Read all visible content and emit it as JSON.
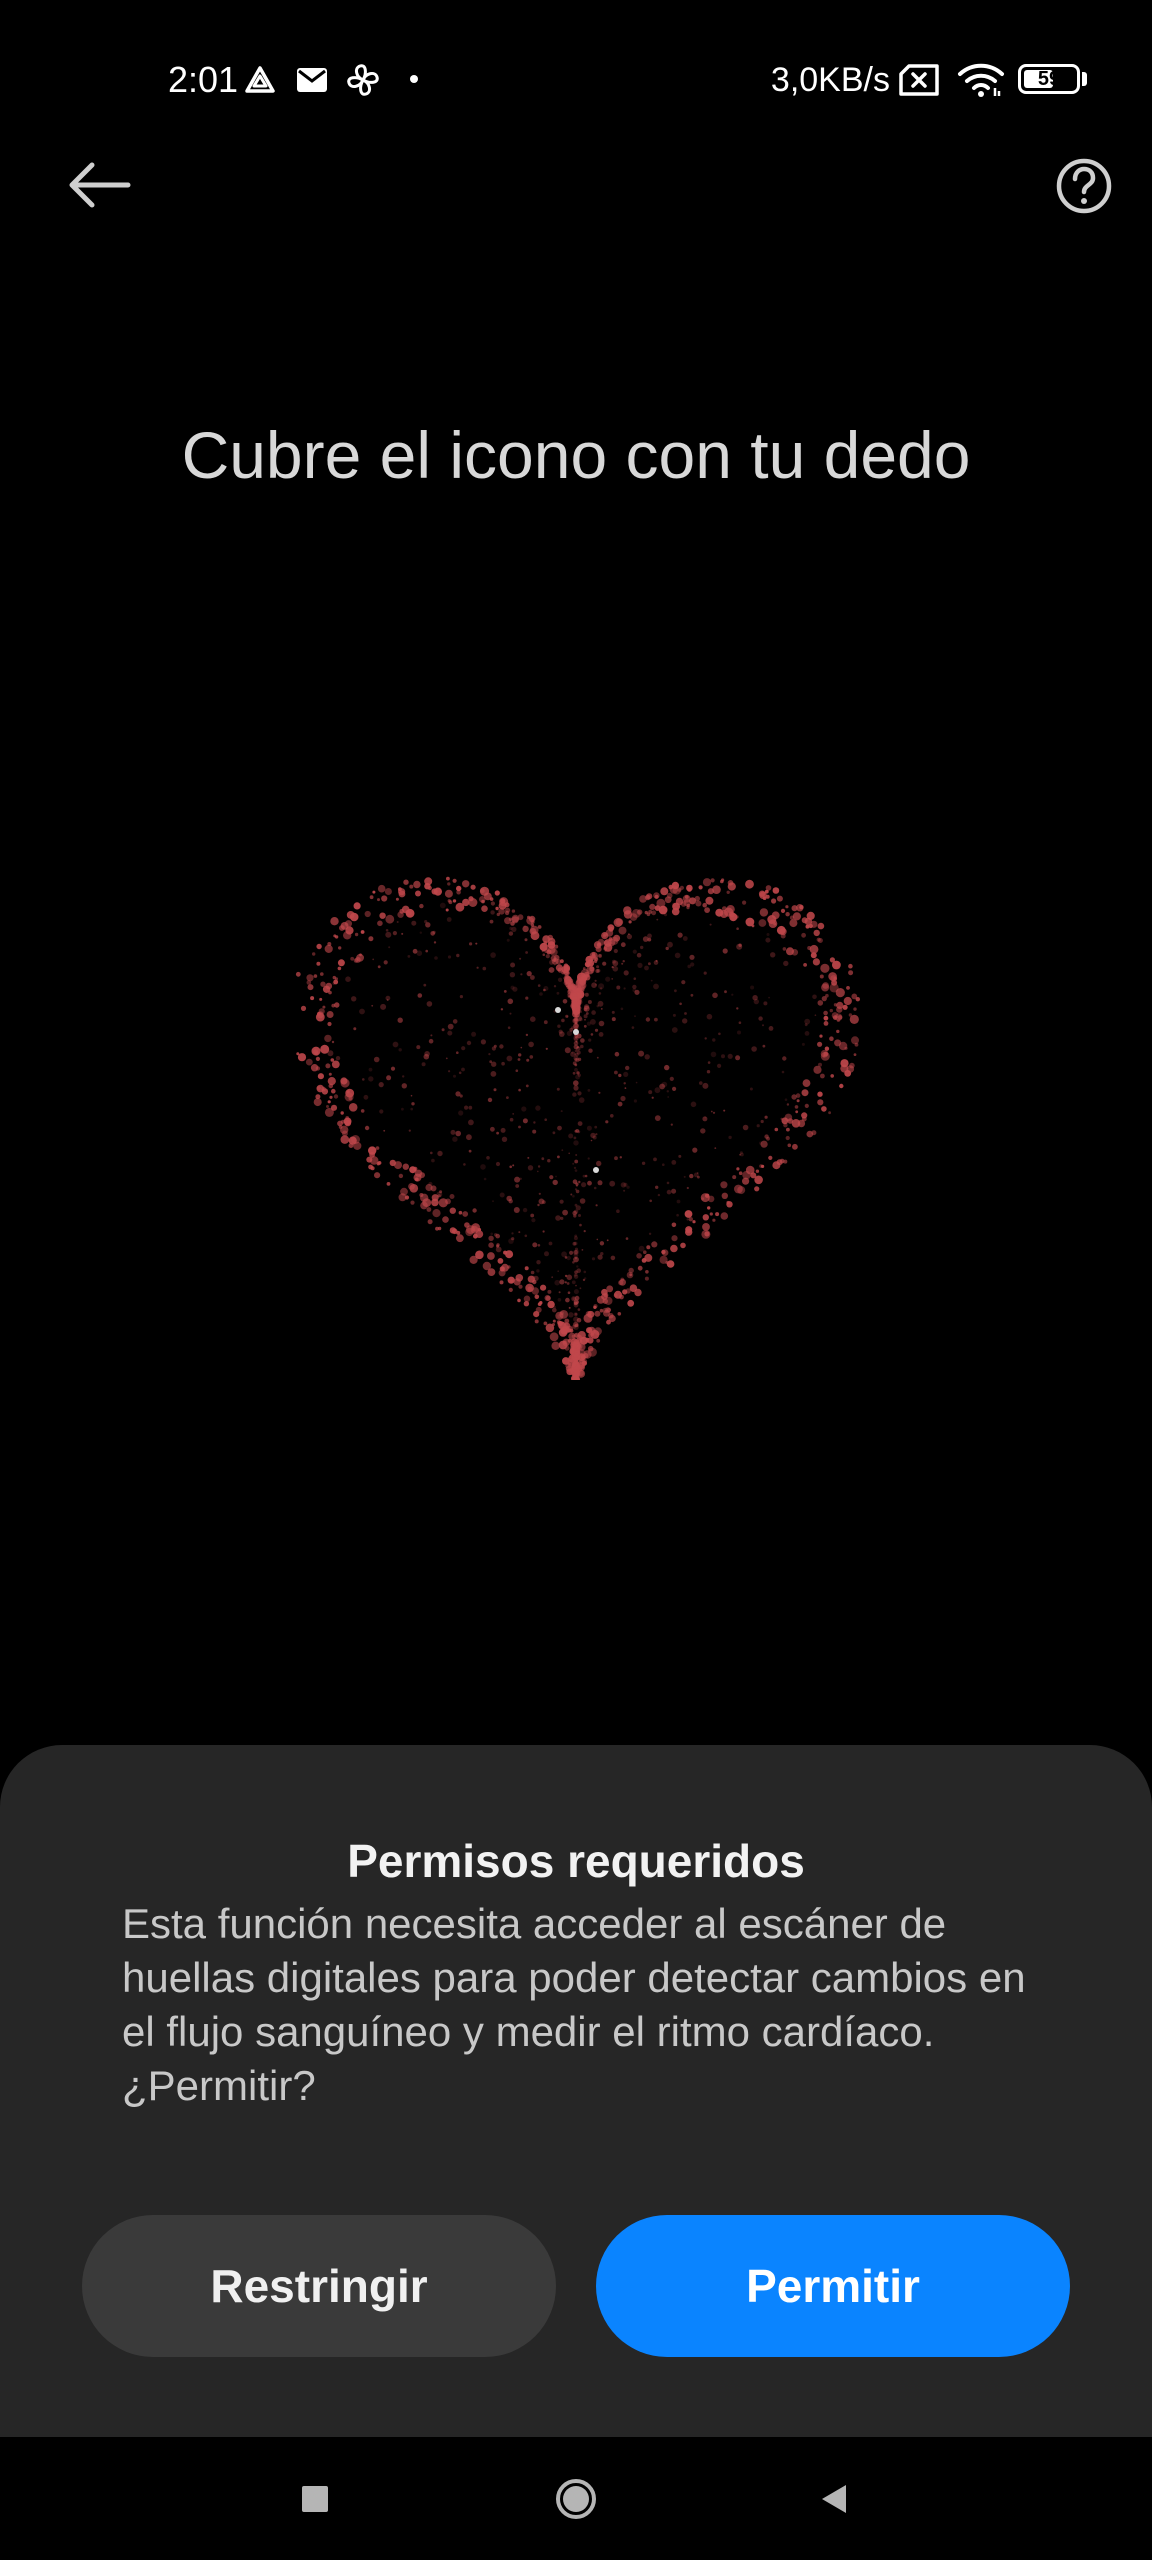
{
  "status_bar": {
    "time": "2:01",
    "net_speed": "3,0KB/s",
    "battery_level": "59",
    "battery_fraction": 0.59,
    "icons": [
      "drive-icon",
      "mail-icon",
      "fan-icon",
      "dot-icon",
      "sim-x-icon",
      "wifi-icon",
      "battery-icon"
    ]
  },
  "header": {
    "back_icon": "arrow-left-icon",
    "help_icon": "help-circle-icon"
  },
  "main": {
    "title": "Cubre el icono con tu dedo",
    "graphic": "heart-particles",
    "heart_color": "#c0474b"
  },
  "sheet": {
    "title": "Permisos requeridos",
    "body": "Esta función necesita acceder al escáner de huellas digitales para poder detectar cambios en el flujo sanguíneo y medir el ritmo cardíaco. ¿Permitir?",
    "restrict_label": "Restringir",
    "allow_label": "Permitir",
    "allow_color": "#0a84ff"
  },
  "nav_bar": {
    "items": [
      "recents-icon",
      "home-icon",
      "back-icon"
    ]
  }
}
